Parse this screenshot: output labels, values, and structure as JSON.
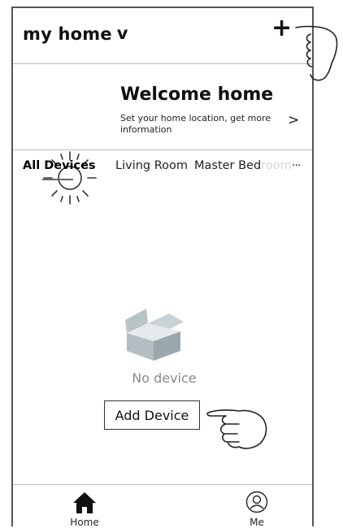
{
  "header": {
    "title": "my home",
    "chevron": "v",
    "add_icon": "+"
  },
  "welcome": {
    "icon": "sun-icon",
    "title": "Welcome home",
    "subtitle": "Set your home location, get more information",
    "arrow": ">"
  },
  "tabs": {
    "items": [
      {
        "label": "All Devices",
        "active": true
      },
      {
        "label": "Living Room",
        "active": false
      }
    ],
    "truncated_tab_main": "Master Bed",
    "truncated_tab_faded": "room",
    "more": "···"
  },
  "empty_state": {
    "icon": "empty-box-icon",
    "message": "No device",
    "add_button": "Add Device"
  },
  "bottom_nav": {
    "home_label": "Home",
    "me_label": "Me"
  }
}
